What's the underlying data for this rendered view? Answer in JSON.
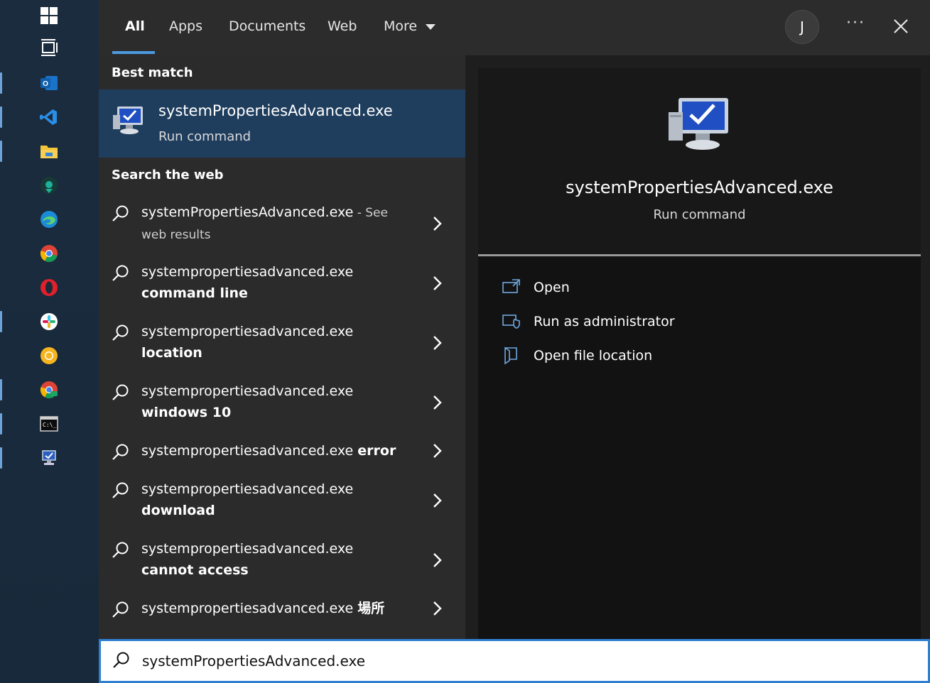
{
  "tabs": [
    {
      "label": "All",
      "active": true
    },
    {
      "label": "Apps"
    },
    {
      "label": "Documents"
    },
    {
      "label": "Web"
    },
    {
      "label": "More"
    }
  ],
  "header": {
    "avatar_initial": "J",
    "more_options": "···"
  },
  "best_match": {
    "heading": "Best match",
    "title": "systemPropertiesAdvanced.exe",
    "subtitle": "Run command",
    "icon": "system-properties-icon"
  },
  "web": {
    "heading": "Search the web",
    "items": [
      {
        "prefix": "systemPropertiesAdvanced.exe",
        "suffix": " - See",
        "line2": "web results",
        "kind": "see"
      },
      {
        "prefix": "systempropertiesadvanced.exe",
        "suffix": "command line",
        "kind": "two"
      },
      {
        "prefix": "systempropertiesadvanced.exe",
        "suffix": "location",
        "kind": "two"
      },
      {
        "prefix": "systempropertiesadvanced.exe",
        "suffix": "windows 10",
        "kind": "two"
      },
      {
        "prefix": "systempropertiesadvanced.exe",
        "suffix": "error",
        "kind": "one"
      },
      {
        "prefix": "systempropertiesadvanced.exe",
        "suffix": "download",
        "kind": "two"
      },
      {
        "prefix": "systempropertiesadvanced.exe",
        "suffix": "cannot access",
        "kind": "two"
      },
      {
        "prefix": "systempropertiesadvanced.exe",
        "suffix": "場所",
        "kind": "one"
      }
    ]
  },
  "detail": {
    "title": "systemPropertiesAdvanced.exe",
    "subtitle": "Run command",
    "actions": [
      {
        "label": "Open",
        "icon": "open-icon"
      },
      {
        "label": "Run as administrator",
        "icon": "run-as-admin-icon"
      },
      {
        "label": "Open file location",
        "icon": "open-file-location-icon"
      }
    ]
  },
  "search": {
    "value": "systemPropertiesAdvanced.exe"
  },
  "colors": {
    "accent": "#2f7fd0",
    "selected_bg": "#1f3e5e",
    "tab_underline": "#4c9ae0"
  }
}
